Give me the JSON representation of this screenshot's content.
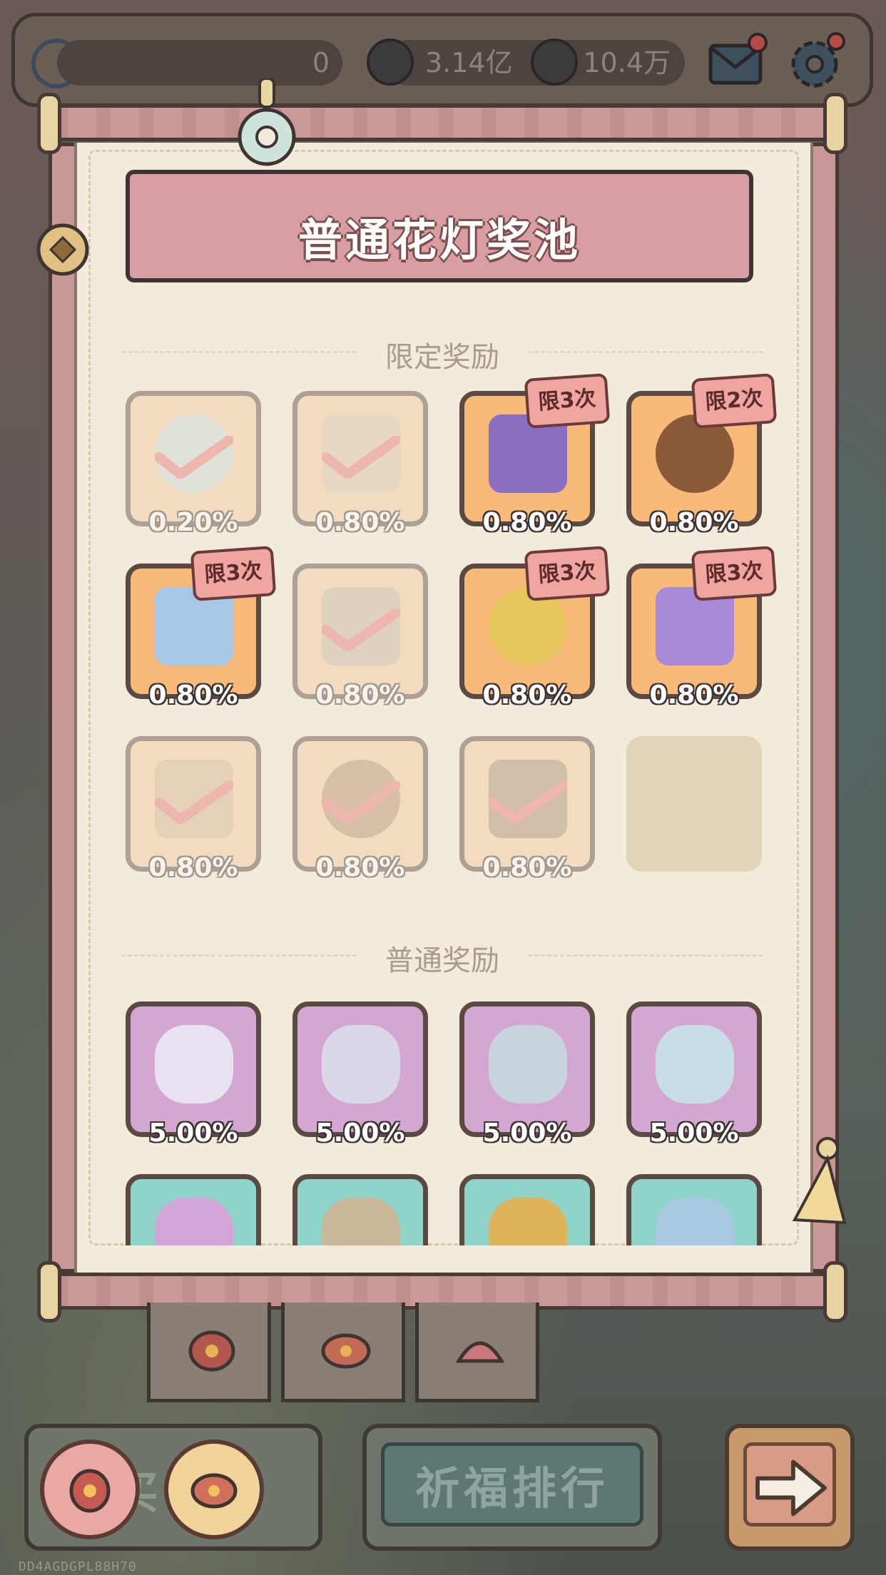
{
  "topbar": {
    "resource1_value": "0",
    "resource2_value": "3.14亿",
    "resource3_value": "10.4万",
    "icons": [
      "clover-icon",
      "ghost-coin-icon",
      "ghost-bubble-icon",
      "mail-icon",
      "settings-icon"
    ]
  },
  "panel": {
    "title": "普通花灯奖池",
    "limited_section": "限定奖励",
    "normal_section": "普通奖励"
  },
  "limited_rewards": [
    {
      "icon": "crystal-icon",
      "rate": "0.20%",
      "claimed": true,
      "limit": ""
    },
    {
      "icon": "paper-scraps-icon",
      "rate": "0.80%",
      "claimed": true,
      "limit": ""
    },
    {
      "icon": "purple-orb-icon",
      "rate": "0.80%",
      "claimed": false,
      "limit": "限3次"
    },
    {
      "icon": "firecracker-icon",
      "rate": "0.80%",
      "claimed": false,
      "limit": "限2次"
    },
    {
      "icon": "holo-ticket-icon",
      "rate": "0.80%",
      "claimed": false,
      "limit": "限3次"
    },
    {
      "icon": "bundle-icon",
      "rate": "0.80%",
      "claimed": true,
      "limit": ""
    },
    {
      "icon": "clover-coin-icon",
      "rate": "0.80%",
      "claimed": false,
      "limit": "限3次"
    },
    {
      "icon": "purple-star-icon",
      "rate": "0.80%",
      "claimed": false,
      "limit": "限3次"
    },
    {
      "icon": "scroll-pieces-icon",
      "rate": "0.80%",
      "claimed": true,
      "limit": ""
    },
    {
      "icon": "portrait-frame-icon",
      "rate": "0.80%",
      "claimed": true,
      "limit": ""
    },
    {
      "icon": "map-frame-icon",
      "rate": "0.80%",
      "claimed": true,
      "limit": ""
    }
  ],
  "normal_rewards": [
    {
      "icon": "ghost-potion-icon",
      "rate": "5.00%",
      "bg": "#d4a6d2"
    },
    {
      "icon": "snail-potion-icon",
      "rate": "5.00%",
      "bg": "#d4a6d2"
    },
    {
      "icon": "molecule-potion-icon",
      "rate": "5.00%",
      "bg": "#d4a6d2"
    },
    {
      "icon": "hourglass-potion-icon",
      "rate": "5.00%",
      "bg": "#d4a6d2"
    },
    {
      "icon": "ticket-roll-icon",
      "rate": "",
      "bg": "#8fd3c9"
    },
    {
      "icon": "machine-icon",
      "rate": "",
      "bg": "#8fd3c9"
    },
    {
      "icon": "mushroom-icon",
      "rate": "",
      "bg": "#8fd3c9"
    },
    {
      "icon": "bottle-icon",
      "rate": "",
      "bg": "#8fd3c9"
    }
  ],
  "bottom": {
    "buy_label": "买",
    "pray_rank_label": "祈福排行",
    "footer_code": "DD4AGDGPL88H70"
  },
  "colors": {
    "limited_bg": "#f9b979",
    "claimed_bg": "#f6c9a0",
    "check": "#e87b7b"
  }
}
